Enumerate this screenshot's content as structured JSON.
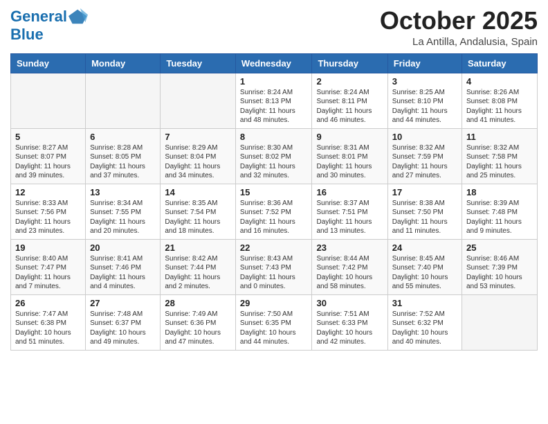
{
  "header": {
    "logo_line1": "General",
    "logo_line2": "Blue",
    "month_title": "October 2025",
    "location": "La Antilla, Andalusia, Spain"
  },
  "columns": [
    "Sunday",
    "Monday",
    "Tuesday",
    "Wednesday",
    "Thursday",
    "Friday",
    "Saturday"
  ],
  "weeks": [
    [
      {
        "day": "",
        "text": ""
      },
      {
        "day": "",
        "text": ""
      },
      {
        "day": "",
        "text": ""
      },
      {
        "day": "1",
        "text": "Sunrise: 8:24 AM\nSunset: 8:13 PM\nDaylight: 11 hours\nand 48 minutes."
      },
      {
        "day": "2",
        "text": "Sunrise: 8:24 AM\nSunset: 8:11 PM\nDaylight: 11 hours\nand 46 minutes."
      },
      {
        "day": "3",
        "text": "Sunrise: 8:25 AM\nSunset: 8:10 PM\nDaylight: 11 hours\nand 44 minutes."
      },
      {
        "day": "4",
        "text": "Sunrise: 8:26 AM\nSunset: 8:08 PM\nDaylight: 11 hours\nand 41 minutes."
      }
    ],
    [
      {
        "day": "5",
        "text": "Sunrise: 8:27 AM\nSunset: 8:07 PM\nDaylight: 11 hours\nand 39 minutes."
      },
      {
        "day": "6",
        "text": "Sunrise: 8:28 AM\nSunset: 8:05 PM\nDaylight: 11 hours\nand 37 minutes."
      },
      {
        "day": "7",
        "text": "Sunrise: 8:29 AM\nSunset: 8:04 PM\nDaylight: 11 hours\nand 34 minutes."
      },
      {
        "day": "8",
        "text": "Sunrise: 8:30 AM\nSunset: 8:02 PM\nDaylight: 11 hours\nand 32 minutes."
      },
      {
        "day": "9",
        "text": "Sunrise: 8:31 AM\nSunset: 8:01 PM\nDaylight: 11 hours\nand 30 minutes."
      },
      {
        "day": "10",
        "text": "Sunrise: 8:32 AM\nSunset: 7:59 PM\nDaylight: 11 hours\nand 27 minutes."
      },
      {
        "day": "11",
        "text": "Sunrise: 8:32 AM\nSunset: 7:58 PM\nDaylight: 11 hours\nand 25 minutes."
      }
    ],
    [
      {
        "day": "12",
        "text": "Sunrise: 8:33 AM\nSunset: 7:56 PM\nDaylight: 11 hours\nand 23 minutes."
      },
      {
        "day": "13",
        "text": "Sunrise: 8:34 AM\nSunset: 7:55 PM\nDaylight: 11 hours\nand 20 minutes."
      },
      {
        "day": "14",
        "text": "Sunrise: 8:35 AM\nSunset: 7:54 PM\nDaylight: 11 hours\nand 18 minutes."
      },
      {
        "day": "15",
        "text": "Sunrise: 8:36 AM\nSunset: 7:52 PM\nDaylight: 11 hours\nand 16 minutes."
      },
      {
        "day": "16",
        "text": "Sunrise: 8:37 AM\nSunset: 7:51 PM\nDaylight: 11 hours\nand 13 minutes."
      },
      {
        "day": "17",
        "text": "Sunrise: 8:38 AM\nSunset: 7:50 PM\nDaylight: 11 hours\nand 11 minutes."
      },
      {
        "day": "18",
        "text": "Sunrise: 8:39 AM\nSunset: 7:48 PM\nDaylight: 11 hours\nand 9 minutes."
      }
    ],
    [
      {
        "day": "19",
        "text": "Sunrise: 8:40 AM\nSunset: 7:47 PM\nDaylight: 11 hours\nand 7 minutes."
      },
      {
        "day": "20",
        "text": "Sunrise: 8:41 AM\nSunset: 7:46 PM\nDaylight: 11 hours\nand 4 minutes."
      },
      {
        "day": "21",
        "text": "Sunrise: 8:42 AM\nSunset: 7:44 PM\nDaylight: 11 hours\nand 2 minutes."
      },
      {
        "day": "22",
        "text": "Sunrise: 8:43 AM\nSunset: 7:43 PM\nDaylight: 11 hours\nand 0 minutes."
      },
      {
        "day": "23",
        "text": "Sunrise: 8:44 AM\nSunset: 7:42 PM\nDaylight: 10 hours\nand 58 minutes."
      },
      {
        "day": "24",
        "text": "Sunrise: 8:45 AM\nSunset: 7:40 PM\nDaylight: 10 hours\nand 55 minutes."
      },
      {
        "day": "25",
        "text": "Sunrise: 8:46 AM\nSunset: 7:39 PM\nDaylight: 10 hours\nand 53 minutes."
      }
    ],
    [
      {
        "day": "26",
        "text": "Sunrise: 7:47 AM\nSunset: 6:38 PM\nDaylight: 10 hours\nand 51 minutes."
      },
      {
        "day": "27",
        "text": "Sunrise: 7:48 AM\nSunset: 6:37 PM\nDaylight: 10 hours\nand 49 minutes."
      },
      {
        "day": "28",
        "text": "Sunrise: 7:49 AM\nSunset: 6:36 PM\nDaylight: 10 hours\nand 47 minutes."
      },
      {
        "day": "29",
        "text": "Sunrise: 7:50 AM\nSunset: 6:35 PM\nDaylight: 10 hours\nand 44 minutes."
      },
      {
        "day": "30",
        "text": "Sunrise: 7:51 AM\nSunset: 6:33 PM\nDaylight: 10 hours\nand 42 minutes."
      },
      {
        "day": "31",
        "text": "Sunrise: 7:52 AM\nSunset: 6:32 PM\nDaylight: 10 hours\nand 40 minutes."
      },
      {
        "day": "",
        "text": ""
      }
    ]
  ]
}
